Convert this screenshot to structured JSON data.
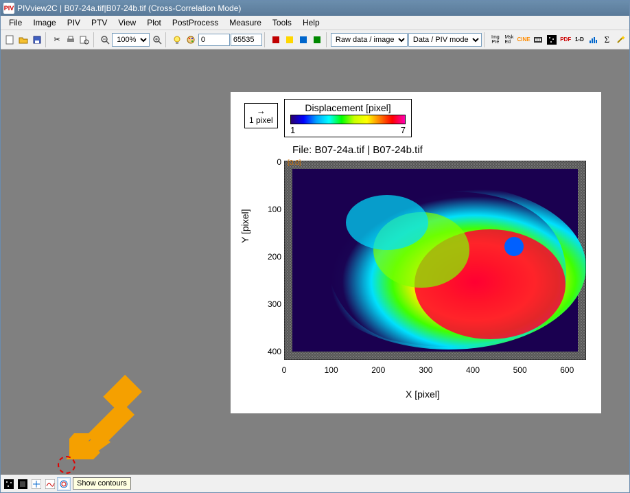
{
  "title": "PIVview2C | B07-24a.tif|B07-24b.tif (Cross-Correlation Mode)",
  "menu": [
    "File",
    "Image",
    "PIV",
    "PTV",
    "View",
    "Plot",
    "PostProcess",
    "Measure",
    "Tools",
    "Help"
  ],
  "toolbar": {
    "zoom_value": "100%",
    "range_lo": "0",
    "range_hi": "65535",
    "combo1": "Raw data / image",
    "combo2": "Data / PIV mode"
  },
  "plot": {
    "vector_legend_arrow": "→",
    "vector_legend_label": "1 pixel",
    "colorbar_title": "Displacement [pixel]",
    "colorbar_min": "1",
    "colorbar_max": "7",
    "file_label": "File: B07-24a.tif | B07-24b.tif",
    "ylabel": "Y [pixel]",
    "xlabel": "X [pixel]",
    "origin_marker": "[0,0]",
    "xticks": [
      "0",
      "100",
      "200",
      "300",
      "400",
      "500",
      "600"
    ],
    "yticks": [
      "0",
      "100",
      "200",
      "300",
      "400"
    ]
  },
  "tooltip": "Show contours",
  "chart_data": {
    "type": "heatmap",
    "title": "Displacement [pixel]",
    "xlabel": "X [pixel]",
    "ylabel": "Y [pixel]",
    "xlim": [
      0,
      640
    ],
    "ylim": [
      0,
      420
    ],
    "colorbar_range": [
      1,
      7
    ],
    "description": "PIV displacement magnitude contour map overlaid on raw image; high-displacement region (red/yellow, ~5–7 px) concentrated in center-right around X≈300–550, Y≈150–350; surrounding cyan/green ring (~2–4 px); dark purple background (~1 px)."
  }
}
